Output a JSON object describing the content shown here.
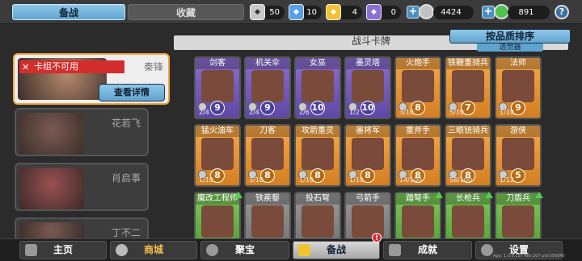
{
  "top": {
    "tab_active": "备战",
    "tab_inactive": "收藏",
    "res": [
      {
        "value": "50",
        "color": "#c8c8c8",
        "icon": "silver-crest-icon"
      },
      {
        "value": "10",
        "color": "#5aa0e8",
        "icon": "blue-crest-icon"
      },
      {
        "value": "4",
        "color": "#f0c431",
        "icon": "gold-crest-icon"
      },
      {
        "value": "0",
        "color": "#8a6fd6",
        "icon": "purple-crest-icon"
      }
    ],
    "coins": "4424",
    "gems": "891",
    "help": "?"
  },
  "sidebar": {
    "warning": "卡组不可用",
    "hero1": "秦锋",
    "detail": "查看详情",
    "hero2": "花若飞",
    "hero3": "肖启事",
    "hero4": "丁不二"
  },
  "deck": {
    "header": "战斗卡牌",
    "sort": "按品质排序",
    "sort_sub": "选觉器"
  },
  "cards": [
    {
      "name": "剑客",
      "cost": "9",
      "lv": "2/4",
      "q": "purple"
    },
    {
      "name": "机关伞",
      "cost": "9",
      "lv": "2/4",
      "q": "purple"
    },
    {
      "name": "女巫",
      "cost": "10",
      "lv": "2/6",
      "q": "purple"
    },
    {
      "name": "墨灵塔",
      "cost": "10",
      "lv": "1/2",
      "q": "purple"
    },
    {
      "name": "火炮手",
      "cost": "8",
      "lv": "3/10",
      "q": "orange"
    },
    {
      "name": "铁鞭重骑兵",
      "cost": "7",
      "lv": "5/10",
      "q": "orange"
    },
    {
      "name": "法师",
      "cost": "9",
      "lv": "1/10",
      "q": "orange"
    },
    {
      "name": "猛火油车",
      "cost": "8",
      "lv": "1/10",
      "q": "orange"
    },
    {
      "name": "刀客",
      "cost": "8",
      "lv": "3/10",
      "q": "orange"
    },
    {
      "name": "攻箭重灵",
      "cost": "8",
      "lv": "1/10",
      "q": "orange"
    },
    {
      "name": "墨将军",
      "cost": "8",
      "lv": "1/10",
      "q": "orange"
    },
    {
      "name": "重斧手",
      "cost": "8",
      "lv": "14/100",
      "q": "orange"
    },
    {
      "name": "三眼铳骑兵",
      "cost": "8",
      "lv": "56/100",
      "q": "orange"
    },
    {
      "name": "游侠",
      "cost": "5",
      "lv": "1/12",
      "q": "orange"
    },
    {
      "name": "魔改工程师",
      "cost": "",
      "lv": "",
      "q": "green"
    },
    {
      "name": "铁蒺藜",
      "cost": "",
      "lv": "",
      "q": "gray"
    },
    {
      "name": "投石弩",
      "cost": "",
      "lv": "",
      "q": "gray"
    },
    {
      "name": "弓箭手",
      "cost": "",
      "lv": "",
      "q": "gray"
    },
    {
      "name": "踏弩手",
      "cost": "",
      "lv": "",
      "q": "green"
    },
    {
      "name": "长枪兵",
      "cost": "",
      "lv": "",
      "q": "green"
    },
    {
      "name": "刀盾兵",
      "cost": "",
      "lv": "",
      "q": "green"
    }
  ],
  "nav": [
    {
      "label": "主页",
      "icon": "home-icon"
    },
    {
      "label": "商城",
      "icon": "shop-icon"
    },
    {
      "label": "聚宝",
      "icon": "treasure-icon"
    },
    {
      "label": "备战",
      "icon": "cards-icon"
    },
    {
      "label": "成就",
      "icon": "achievement-icon"
    },
    {
      "label": "设置",
      "icon": "gear-icon"
    }
  ],
  "badge": "!",
  "version": "App: 1.0.0.157 Res:207 pid:556845"
}
